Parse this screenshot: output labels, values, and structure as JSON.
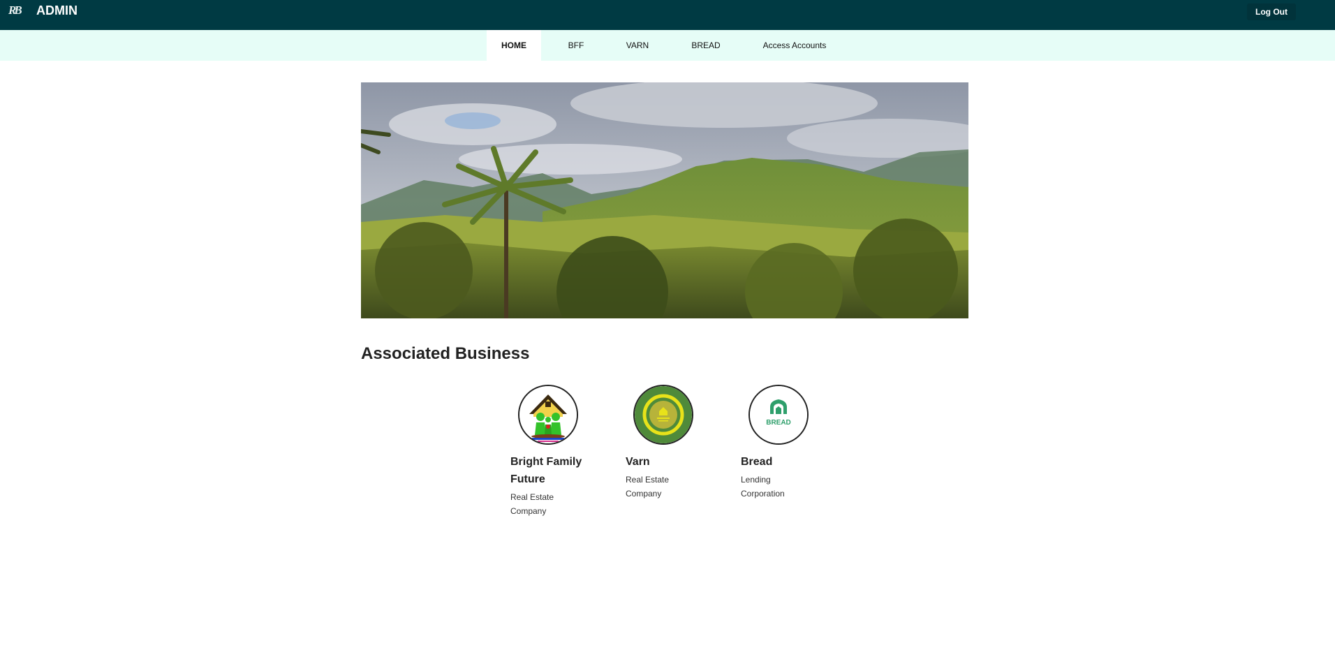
{
  "header": {
    "logo_text": "RB",
    "title": "ADMIN",
    "logout_label": "Log Out"
  },
  "nav": {
    "items": [
      {
        "label": "HOME",
        "active": true
      },
      {
        "label": "BFF",
        "active": false
      },
      {
        "label": "VARN",
        "active": false
      },
      {
        "label": "BREAD",
        "active": false
      },
      {
        "label": "Access Accounts",
        "active": false
      }
    ]
  },
  "main": {
    "section_title": "Associated Business",
    "businesses": [
      {
        "name": "Bright Family Future",
        "desc": "Real Estate Company",
        "logo": "bff-logo-icon"
      },
      {
        "name": "Varn",
        "desc": "Real Estate Company",
        "logo": "varn-logo-icon"
      },
      {
        "name": "Bread",
        "desc": "Lending Corporation",
        "logo": "bread-logo-icon",
        "logo_text": "BREAD"
      }
    ]
  },
  "colors": {
    "topbar": "#003a43",
    "navbar": "#e6fdf7",
    "accent_green": "#2e9f6b"
  }
}
